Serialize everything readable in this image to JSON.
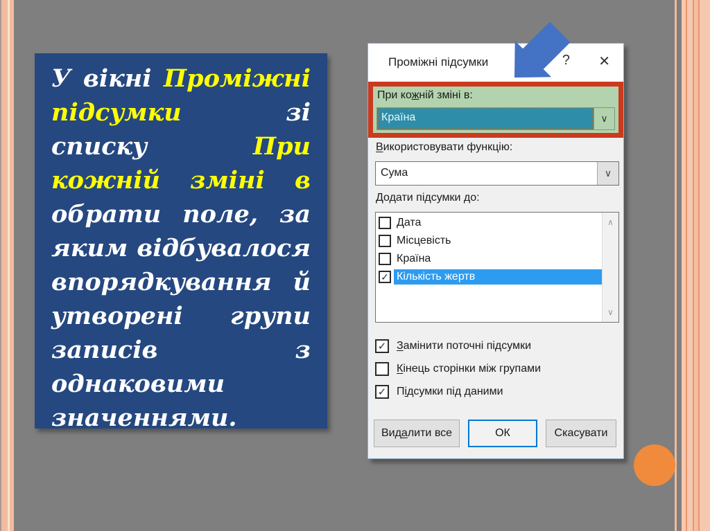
{
  "colors": {
    "background": "#7f7f7f",
    "textbox_bg": "#254880",
    "text_white": "#ffffff",
    "text_yellow": "#ffff00",
    "highlight_red": "#cb3a1f",
    "highlight_green": "#b3d3ae",
    "combobox_teal": "#2e8ea9",
    "selection_blue": "#2d9cf0",
    "arrow_blue": "#4472c4",
    "circle_orange": "#f08a3c",
    "ok_border_blue": "#0078d7"
  },
  "textbox": {
    "lines": [
      {
        "words": [
          {
            "t": "У"
          },
          {
            "t": "вікні"
          },
          {
            "t": "Проміжні"
          }
        ]
      },
      {
        "words": [
          {
            "t": "підсумки"
          },
          {
            "t": "зі"
          }
        ]
      },
      {
        "words": [
          {
            "t": "списку"
          },
          {
            "t": "При"
          }
        ]
      },
      {
        "words": [
          {
            "t": "кожній"
          },
          {
            "t": "зміні"
          },
          {
            "t": "в"
          }
        ]
      },
      {
        "words": [
          {
            "t": "обрати"
          },
          {
            "t": "поле,"
          },
          {
            "t": "за"
          }
        ]
      },
      {
        "words": [
          {
            "t": "яким"
          },
          {
            "t": "відбувалося"
          }
        ]
      },
      {
        "words": [
          {
            "t": "впорядкування"
          },
          {
            "t": "й"
          }
        ]
      },
      {
        "words": [
          {
            "t": "утворені"
          },
          {
            "t": "групи"
          }
        ]
      },
      {
        "words": [
          {
            "t": "записів"
          },
          {
            "t": "з"
          }
        ]
      },
      {
        "words": [
          {
            "t": "однаковими"
          }
        ]
      },
      {
        "words": [
          {
            "t": "значеннями."
          }
        ]
      }
    ]
  },
  "dialog": {
    "title": "Проміжні підсумки",
    "help_icon": "?",
    "close_icon": "✕",
    "group_field": {
      "label": {
        "pre": "При ко",
        "u": "ж",
        "post": "ній зміні в:"
      },
      "value": "Країна"
    },
    "function_field": {
      "label": {
        "pre": "",
        "u": "В",
        "post": "икористовувати функцію:"
      },
      "value": "Сума"
    },
    "add_to": {
      "label": {
        "pre": "",
        "u": "Д",
        "post": "одати підсумки до:"
      },
      "items": [
        {
          "label": "Дата",
          "check": ""
        },
        {
          "label": "Місцевість",
          "check": ""
        },
        {
          "label": "Країна",
          "check": ""
        },
        {
          "label": "Кількість жертв",
          "check": "✓"
        }
      ]
    },
    "options": [
      {
        "label": {
          "pre": "",
          "u": "З",
          "post": "амінити поточні підсумки"
        },
        "check": "✓"
      },
      {
        "label": {
          "pre": "",
          "u": "К",
          "post": "інець сторінки між групами"
        },
        "check": ""
      },
      {
        "label": {
          "pre": "П",
          "u": "і",
          "post": "дсумки під даними"
        },
        "check": "✓"
      }
    ],
    "buttons": {
      "delete_all": {
        "pre": "Вид",
        "u": "а",
        "post": "лити все"
      },
      "ok": {
        "pre": "",
        "u": "",
        "post": "ОК"
      },
      "cancel": {
        "pre": "",
        "u": "",
        "post": "Скасувати"
      }
    },
    "icons": {
      "chevron_down": "∨",
      "scroll_up": "∧",
      "scroll_down": "∨"
    }
  }
}
